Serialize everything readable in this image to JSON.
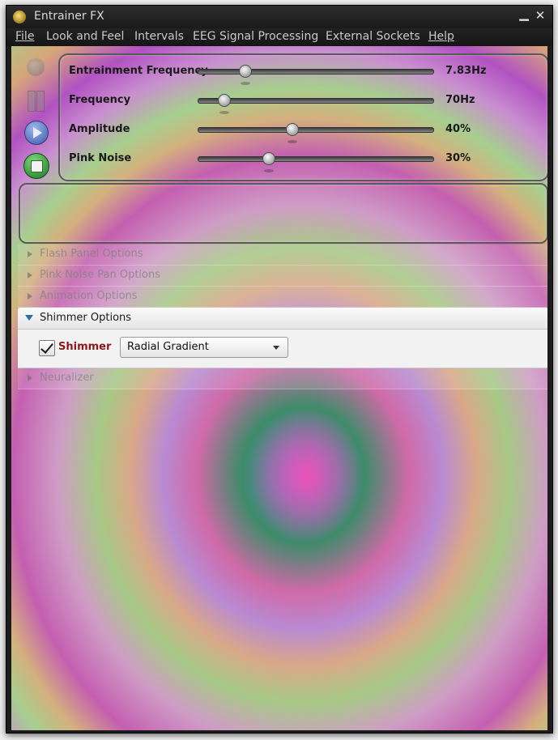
{
  "window": {
    "title": "Entrainer FX",
    "minimize_glyph": "▁",
    "close_glyph": "✕"
  },
  "menu": [
    {
      "label": "File"
    },
    {
      "label": "Look and Feel"
    },
    {
      "label": "Intervals"
    },
    {
      "label": "EEG Signal Processing"
    },
    {
      "label": "External Sockets"
    },
    {
      "label": "Help"
    }
  ],
  "controls": {
    "record_icon": "record-icon",
    "pause_icon": "pause-icon",
    "play_icon": "play-icon",
    "stop_icon": "stop-icon"
  },
  "sliders": [
    {
      "label": "Entrainment Frequency",
      "value": "7.83Hz",
      "fraction": 0.2
    },
    {
      "label": "Frequency",
      "value": "70Hz",
      "fraction": 0.11
    },
    {
      "label": "Amplitude",
      "value": "40%",
      "fraction": 0.4
    },
    {
      "label": "Pink Noise",
      "value": "30%",
      "fraction": 0.3
    }
  ],
  "accordion": {
    "flash": "Flash Panel Options",
    "pink_noise_pan": "Pink Noise Pan Options",
    "animation": "Animation Options",
    "shimmer": "Shimmer Options",
    "neuralizer": "Neuralizer"
  },
  "shimmer": {
    "checkbox_label": "Shimmer",
    "checked": true,
    "type_selected": "Radial Gradient"
  },
  "colors": {
    "play_button": "#3b5aa6",
    "stop_button": "#1a7a22",
    "expanded_arrow": "#246fa8",
    "shimmer_label": "#8a1a1a"
  }
}
